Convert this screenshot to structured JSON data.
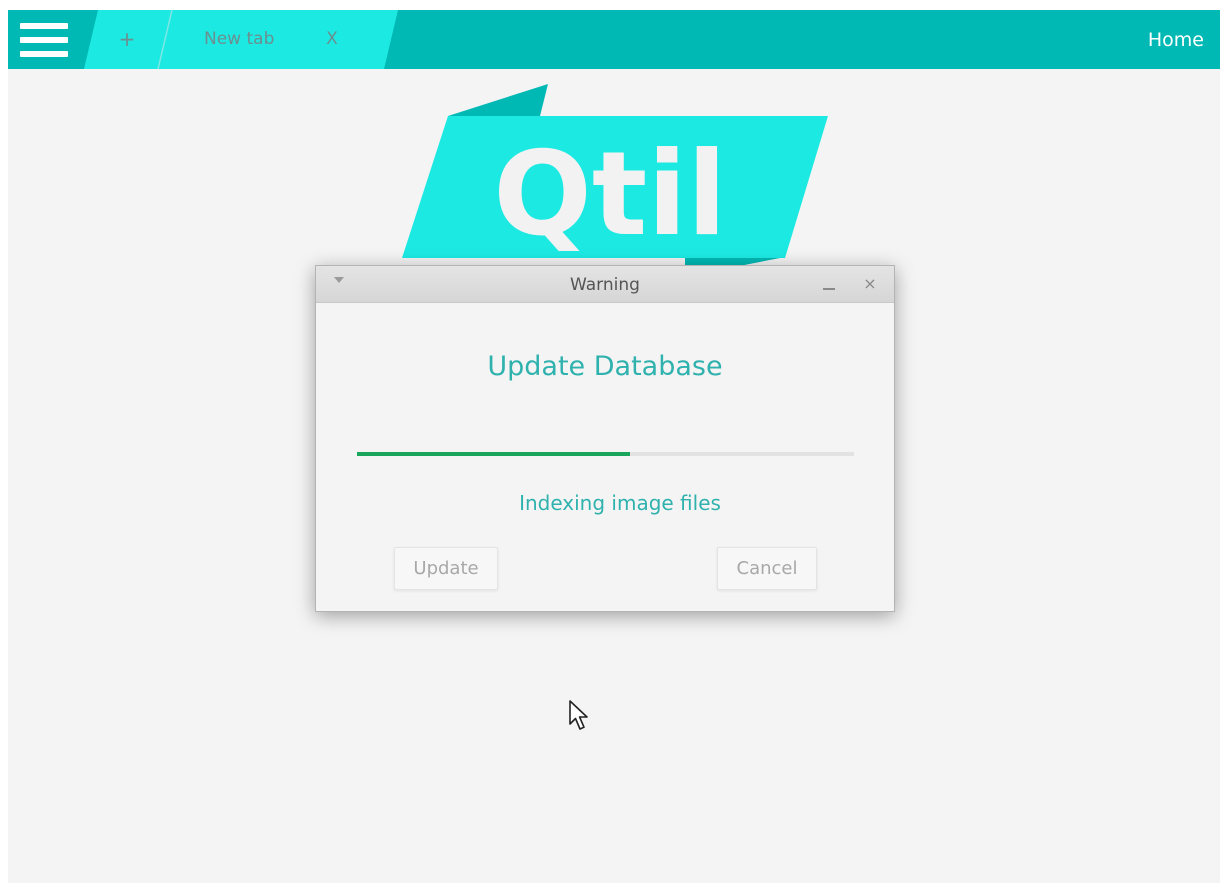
{
  "topbar": {
    "new_tab_label": "+",
    "tab_label": "New tab",
    "tab_close_label": "X",
    "home_label": "Home"
  },
  "logo": {
    "text": "Qtil"
  },
  "dialog": {
    "title": "Warning",
    "close_label": "×",
    "heading": "Update Database",
    "progress": 0.55,
    "status": "Indexing image files",
    "update_label": "Update",
    "cancel_label": "Cancel"
  },
  "colors": {
    "topbar": "#00b9b4",
    "tab_active": "#1de9e3",
    "accent_text": "#2fb2ae",
    "progress": "#1aa65a"
  },
  "icons": {
    "menu": "hamburger-icon",
    "dialog_menu": "triangle-down-icon",
    "minimize": "minimize-icon",
    "close": "close-icon",
    "cursor": "mouse-pointer-icon"
  }
}
